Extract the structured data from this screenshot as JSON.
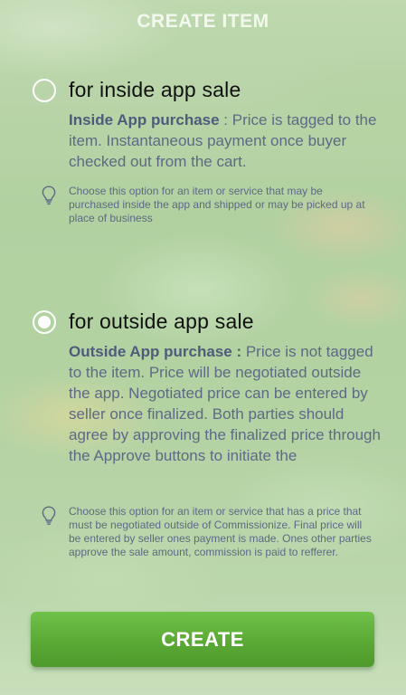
{
  "header": {
    "title": "CREATE ITEM"
  },
  "options": [
    {
      "title": "for inside app sale",
      "selected": false,
      "desc_bold": "Inside App purchase",
      "desc_text": " : Price is tagged to the item. Instantaneous payment once buyer checked out from the cart.",
      "tip_icon": "lightbulb-icon",
      "tip": "Choose this option for an item or service that may be purchased inside the app and shipped or may be picked up at place of business"
    },
    {
      "title": "for outside app sale",
      "selected": true,
      "desc_bold": "Outside App purchase :",
      "desc_text": " Price is not tagged to the item. Price will be negotiated outside the app. Negotiated price can be entered by seller once finalized. Both parties should agree by approving the finalized price through the Approve buttons to initiate the",
      "tip_icon": "lightbulb-icon",
      "tip": "Choose this option for an item or service that has a price that must be negotiated outside of Commissionize. Final price will be entered by seller ones payment is made. Ones other parties approve the sale amount, commission is paid to refferer."
    }
  ],
  "create_button": {
    "label": "CREATE"
  },
  "colors": {
    "accent_green": "#5aa935",
    "body_text": "#5e6986",
    "title_text": "#111111",
    "header_text": "#f3f8ef"
  }
}
